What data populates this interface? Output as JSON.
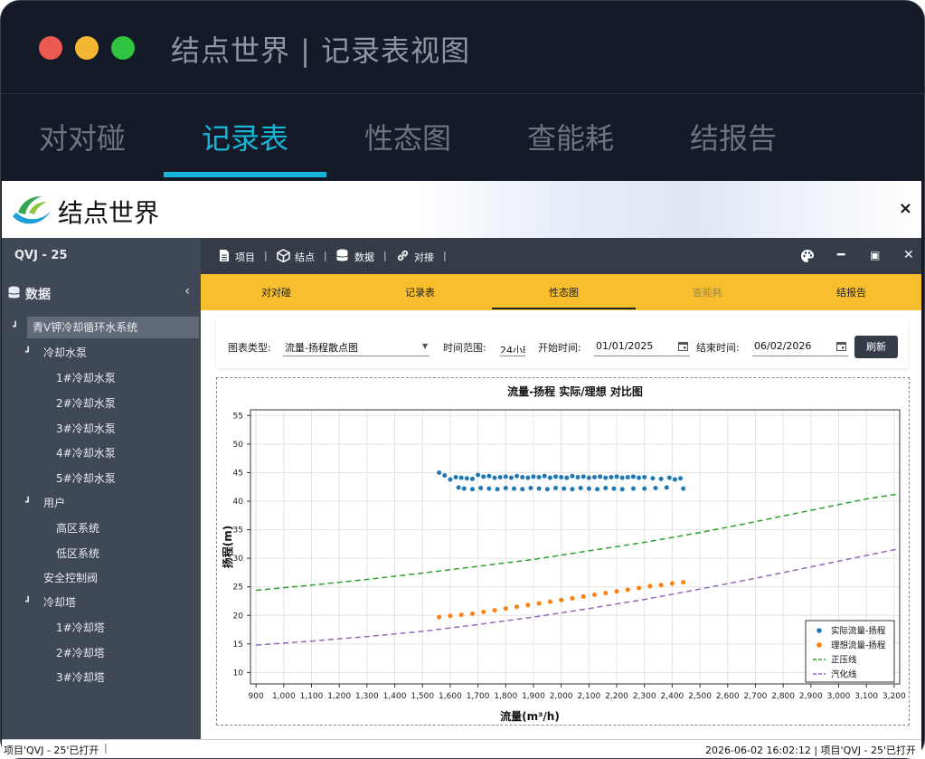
{
  "window": {
    "title": "结点世界 | 记录表视图"
  },
  "main_tabs": [
    {
      "label": "对对碰"
    },
    {
      "label": "记录表"
    },
    {
      "label": "性态图"
    },
    {
      "label": "查能耗"
    },
    {
      "label": "结报告"
    }
  ],
  "brand": {
    "name": "结点世界",
    "close": "×"
  },
  "sidebar": {
    "header": "QVJ - 25",
    "section_label": "数据",
    "collapse_glyph": "‹",
    "tree": [
      {
        "label": "青V钾冷却循环水系统"
      },
      {
        "label": "冷却水泵"
      },
      {
        "label": "1#冷却水泵"
      },
      {
        "label": "2#冷却水泵"
      },
      {
        "label": "3#冷却水泵"
      },
      {
        "label": "4#冷却水泵"
      },
      {
        "label": "5#冷却水泵"
      },
      {
        "label": "用户"
      },
      {
        "label": "高区系统"
      },
      {
        "label": "低区系统"
      },
      {
        "label": "安全控制阀"
      },
      {
        "label": "冷却塔"
      },
      {
        "label": "1#冷却塔"
      },
      {
        "label": "2#冷却塔"
      },
      {
        "label": "3#冷却塔"
      }
    ]
  },
  "toolbar": {
    "items": [
      {
        "label": "项目",
        "icon": "file-icon"
      },
      {
        "label": "结点",
        "icon": "cube-icon"
      },
      {
        "label": "数据",
        "icon": "database-icon"
      },
      {
        "label": "对接",
        "icon": "link-icon"
      }
    ]
  },
  "sub_tabs": [
    {
      "label": "对对碰"
    },
    {
      "label": "记录表"
    },
    {
      "label": "性态图"
    },
    {
      "label": "查能耗"
    },
    {
      "label": "结报告"
    }
  ],
  "filters": {
    "chart_type_label": "图表类型:",
    "chart_type_value": "流量-扬程散点图",
    "time_range_label": "时间范围:",
    "time_range_value": "24小时",
    "start_label": "开始时间:",
    "start_value": "01/01/2025",
    "end_label": "结束时间:",
    "end_value": "06/02/2026",
    "refresh_label": "刷新"
  },
  "status": {
    "left": "项目'QVJ - 25'已打开",
    "right": "2026-06-02 16:02:12 | 项目'QVJ - 25'已打开"
  },
  "colors": {
    "accent": "#17b5d8",
    "tab_bar": "#f7be2d",
    "actual": "#1f77b4",
    "ideal": "#ff7f0e",
    "positive": "#2ca02c",
    "cavitation": "#9467bd"
  },
  "chart_data": {
    "type": "scatter",
    "title": "流量-扬程 实际/理想 对比图",
    "xlabel": "流量(m³/h)",
    "ylabel": "扬程(m)",
    "xlim": [
      880,
      3220
    ],
    "ylim": [
      8,
      56
    ],
    "xticks": [
      900,
      1000,
      1100,
      1200,
      1300,
      1400,
      1500,
      1600,
      1700,
      1800,
      1900,
      2000,
      2100,
      2200,
      2300,
      2400,
      2500,
      2600,
      2700,
      2800,
      2900,
      3000,
      3100,
      3200
    ],
    "xtick_labels": [
      "900",
      "1,000",
      "1,100",
      "1,200",
      "1,300",
      "1,400",
      "1,500",
      "1,600",
      "1,700",
      "1,800",
      "1,900",
      "2,000",
      "2,100",
      "2,200",
      "2,300",
      "2,400",
      "2,500",
      "2,600",
      "2,700",
      "2,800",
      "2,900",
      "3,000",
      "3,100",
      "3,200"
    ],
    "yticks": [
      10,
      15,
      20,
      25,
      30,
      35,
      40,
      45,
      50,
      55
    ],
    "ytick_labels": [
      "10",
      "15",
      "20",
      "25",
      "30",
      "35",
      "40",
      "45",
      "50",
      "55"
    ],
    "grid": true,
    "legend_position": "bottom-right",
    "series": [
      {
        "name": "实际流量-扬程",
        "kind": "points",
        "color": "#1f77b4",
        "points": [
          [
            1560,
            45
          ],
          [
            1580,
            44.5
          ],
          [
            1600,
            43.8
          ],
          [
            1620,
            44.2
          ],
          [
            1640,
            44.1
          ],
          [
            1660,
            44
          ],
          [
            1680,
            43.9
          ],
          [
            1700,
            44.6
          ],
          [
            1720,
            44.3
          ],
          [
            1740,
            44.4
          ],
          [
            1760,
            44.1
          ],
          [
            1780,
            44.2
          ],
          [
            1800,
            44.3
          ],
          [
            1820,
            44.1
          ],
          [
            1840,
            44.4
          ],
          [
            1860,
            44.2
          ],
          [
            1880,
            44.1
          ],
          [
            1900,
            44.3
          ],
          [
            1920,
            44.2
          ],
          [
            1940,
            44.4
          ],
          [
            1960,
            44.1
          ],
          [
            1980,
            44.3
          ],
          [
            2000,
            44.2
          ],
          [
            2020,
            44.1
          ],
          [
            2040,
            44.4
          ],
          [
            2060,
            44.2
          ],
          [
            2080,
            44.3
          ],
          [
            2100,
            44.1
          ],
          [
            2120,
            44.2
          ],
          [
            2140,
            44.3
          ],
          [
            2160,
            44.1
          ],
          [
            2180,
            44.2
          ],
          [
            2200,
            44.3
          ],
          [
            2220,
            44.1
          ],
          [
            2240,
            44.2
          ],
          [
            2260,
            44.3
          ],
          [
            2280,
            44.1
          ],
          [
            2300,
            44.2
          ],
          [
            2330,
            44
          ],
          [
            2360,
            43.9
          ],
          [
            2390,
            44.1
          ],
          [
            2410,
            43.8
          ],
          [
            2430,
            44
          ],
          [
            1630,
            42.4
          ],
          [
            1650,
            42.2
          ],
          [
            1680,
            42.1
          ],
          [
            1710,
            42.3
          ],
          [
            1740,
            42.2
          ],
          [
            1770,
            42.1
          ],
          [
            1800,
            42.3
          ],
          [
            1830,
            42.2
          ],
          [
            1860,
            42.1
          ],
          [
            1890,
            42.3
          ],
          [
            1920,
            42.2
          ],
          [
            1950,
            42.1
          ],
          [
            1980,
            42.3
          ],
          [
            2010,
            42.2
          ],
          [
            2040,
            42.1
          ],
          [
            2070,
            42.3
          ],
          [
            2100,
            42.2
          ],
          [
            2130,
            42.1
          ],
          [
            2160,
            42.3
          ],
          [
            2190,
            42.2
          ],
          [
            2220,
            42.1
          ],
          [
            2260,
            42.2
          ],
          [
            2300,
            42.2
          ],
          [
            2340,
            42.3
          ],
          [
            2380,
            42.4
          ],
          [
            2440,
            42.2
          ]
        ]
      },
      {
        "name": "理想流量-扬程",
        "kind": "points",
        "color": "#ff7f0e",
        "points": [
          [
            1560,
            19.7
          ],
          [
            1600,
            19.9
          ],
          [
            1640,
            20.1
          ],
          [
            1680,
            20.3
          ],
          [
            1720,
            20.6
          ],
          [
            1760,
            20.9
          ],
          [
            1800,
            21.2
          ],
          [
            1840,
            21.5
          ],
          [
            1880,
            21.8
          ],
          [
            1920,
            22.1
          ],
          [
            1960,
            22.4
          ],
          [
            2000,
            22.7
          ],
          [
            2040,
            23
          ],
          [
            2080,
            23.3
          ],
          [
            2120,
            23.6
          ],
          [
            2160,
            23.9
          ],
          [
            2200,
            24.2
          ],
          [
            2240,
            24.5
          ],
          [
            2280,
            24.8
          ],
          [
            2320,
            25.1
          ],
          [
            2360,
            25.3
          ],
          [
            2400,
            25.6
          ],
          [
            2440,
            25.8
          ]
        ]
      },
      {
        "name": "正压线",
        "kind": "dashed",
        "color": "#2ca02c",
        "points": [
          [
            900,
            24.4
          ],
          [
            1100,
            25.3
          ],
          [
            1300,
            26.3
          ],
          [
            1500,
            27.4
          ],
          [
            1700,
            28.6
          ],
          [
            1900,
            29.8
          ],
          [
            2100,
            31.3
          ],
          [
            2300,
            32.8
          ],
          [
            2500,
            34.5
          ],
          [
            2700,
            36.4
          ],
          [
            2900,
            38.4
          ],
          [
            3100,
            40.4
          ],
          [
            3220,
            41.3
          ]
        ]
      },
      {
        "name": "汽化线",
        "kind": "dashed",
        "color": "#9467bd",
        "points": [
          [
            900,
            14.8
          ],
          [
            1100,
            15.5
          ],
          [
            1300,
            16.3
          ],
          [
            1500,
            17.2
          ],
          [
            1700,
            18.4
          ],
          [
            1900,
            19.7
          ],
          [
            2100,
            21.2
          ],
          [
            2300,
            22.8
          ],
          [
            2500,
            24.6
          ],
          [
            2700,
            26.5
          ],
          [
            2900,
            28.5
          ],
          [
            3100,
            30.5
          ],
          [
            3220,
            31.7
          ]
        ]
      }
    ]
  }
}
